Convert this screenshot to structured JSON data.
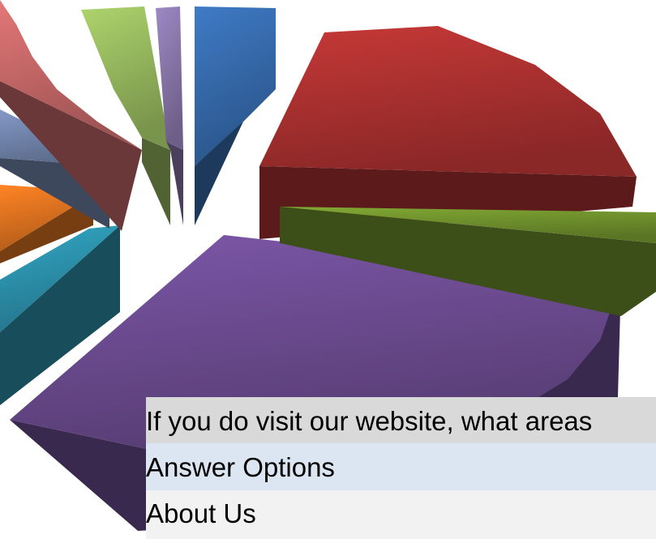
{
  "chart_data": {
    "type": "pie",
    "title": "",
    "exploded": true,
    "style": "3d",
    "slices": [
      {
        "color": "#6a4a8e"
      },
      {
        "color": "#2b8ea8"
      },
      {
        "color": "#d9701f"
      },
      {
        "color": "#6f82a8"
      },
      {
        "color": "#c16565"
      },
      {
        "color": "#93b45c"
      },
      {
        "color": "#8674a6"
      },
      {
        "color": "#3568a8"
      },
      {
        "color": "#a8302f"
      },
      {
        "color": "#6e8f2c"
      }
    ]
  },
  "table": {
    "question": "If you do visit our website, what areas",
    "header": "Answer Options",
    "rows": [
      "About Us"
    ]
  }
}
